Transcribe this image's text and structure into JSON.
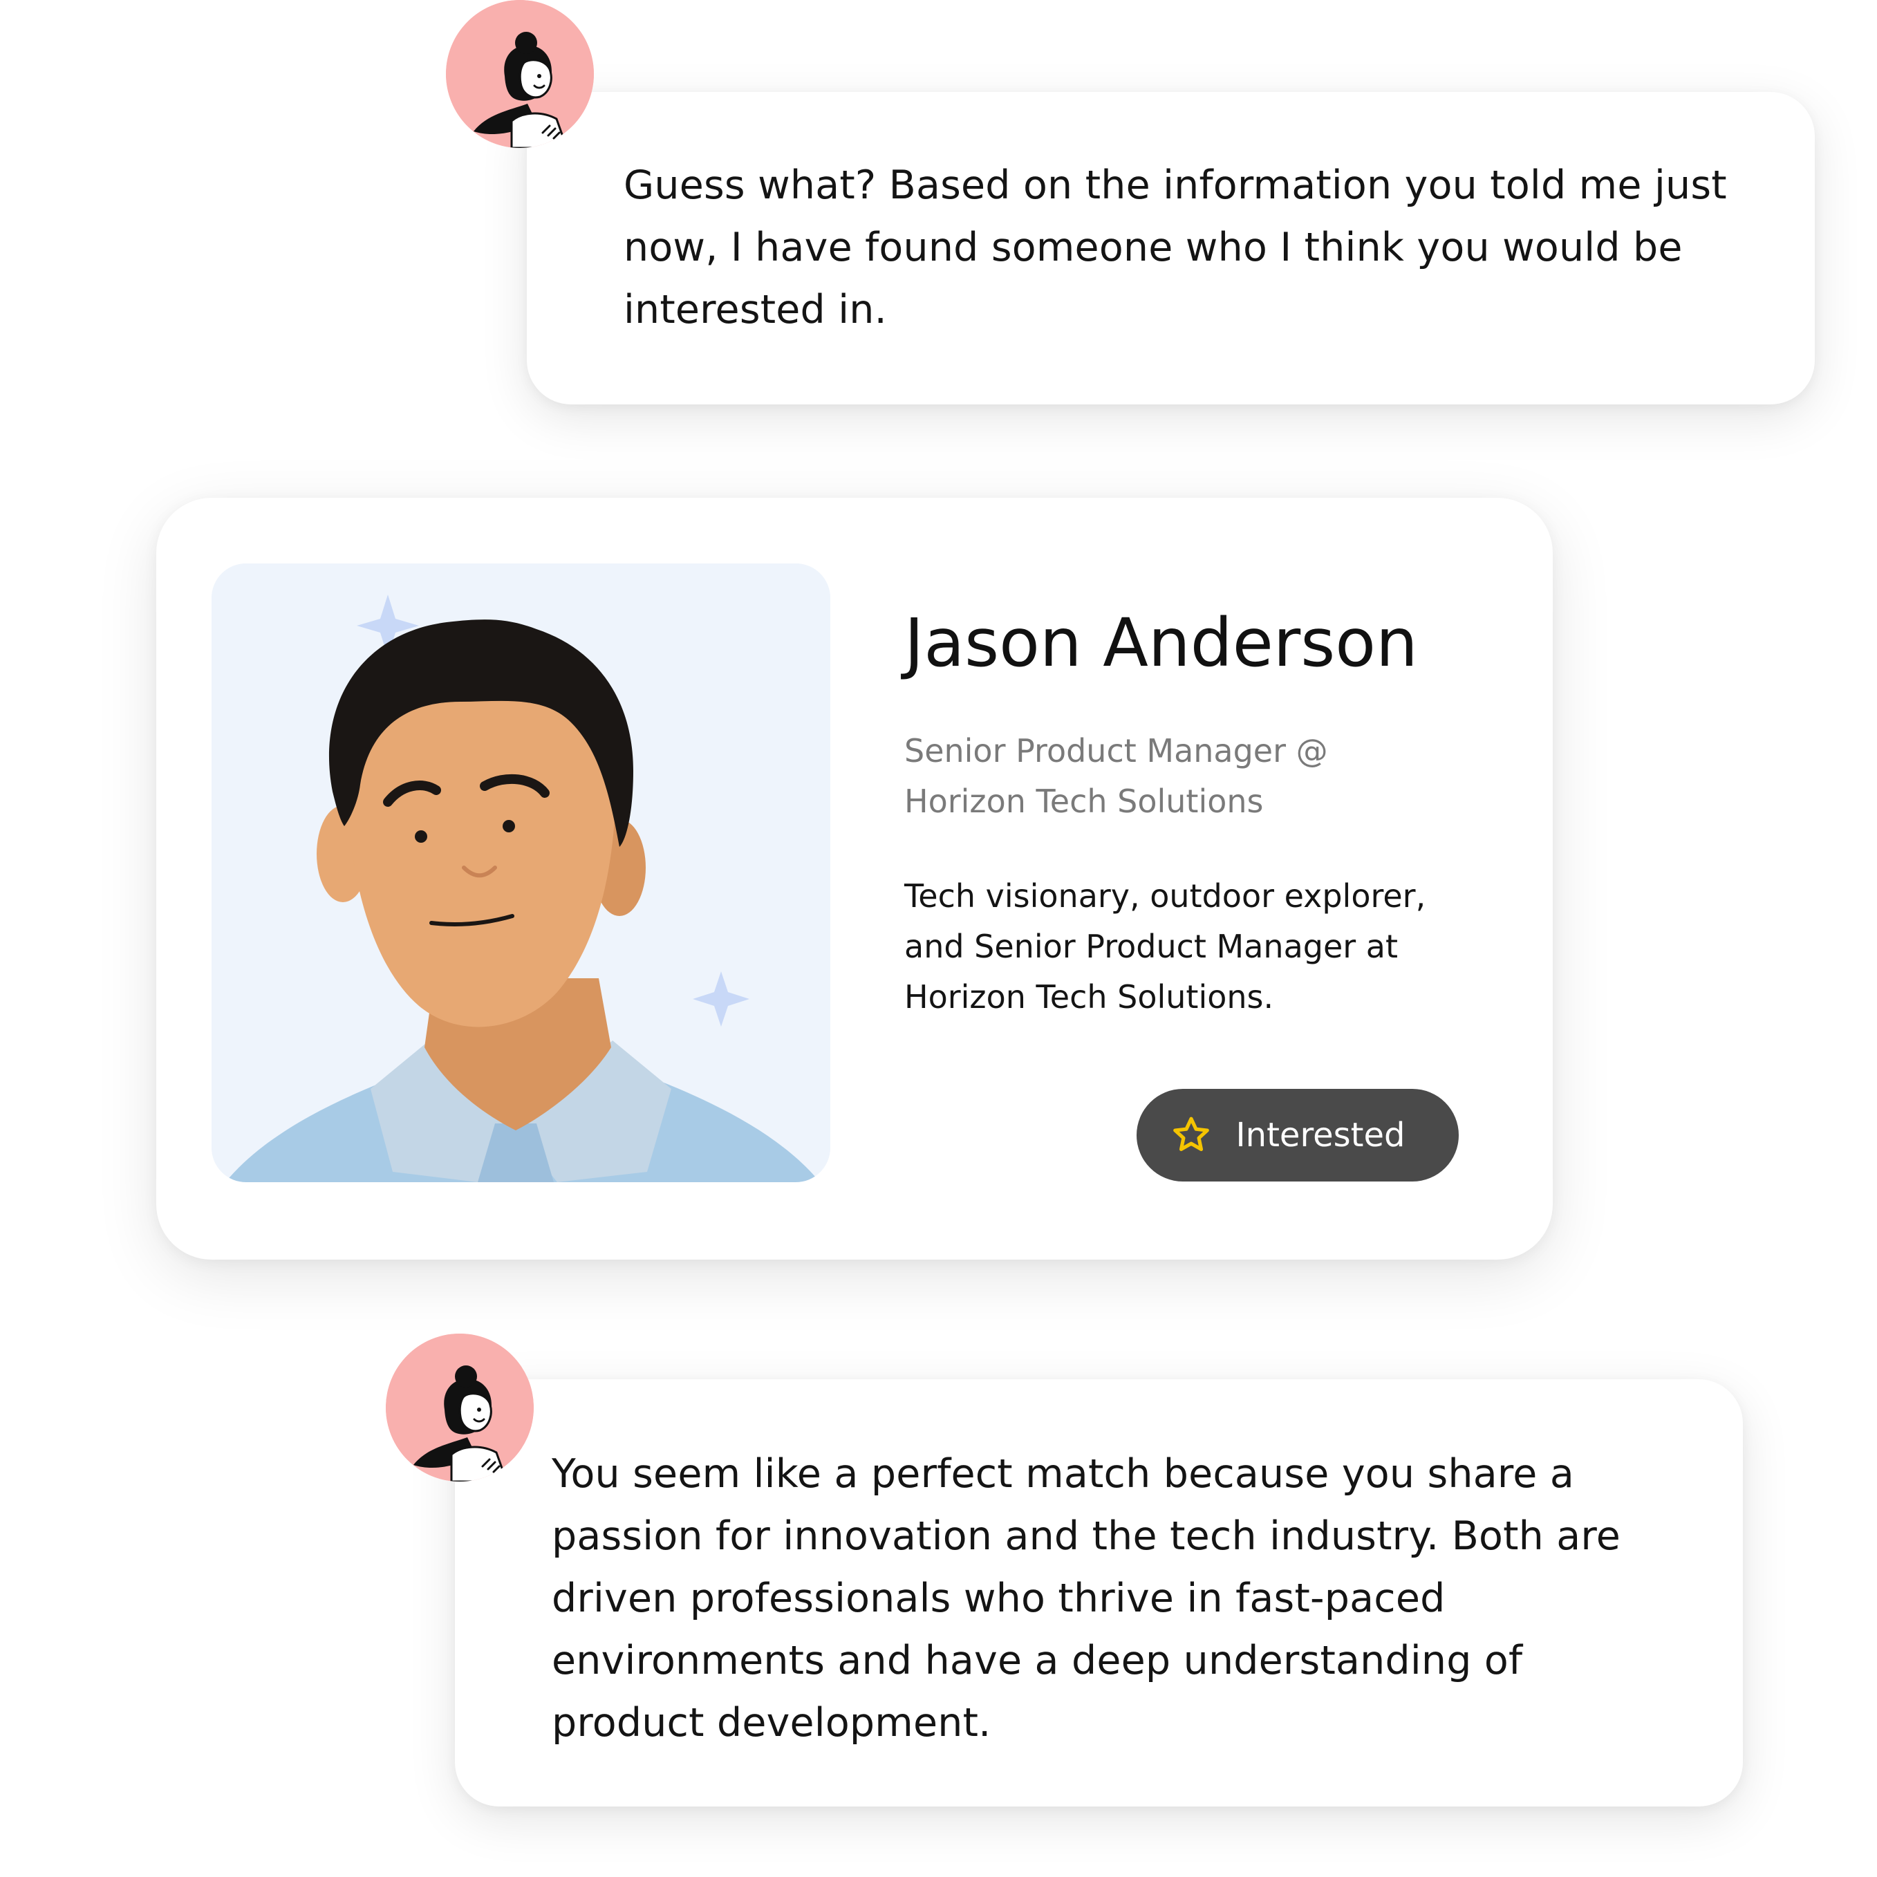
{
  "messages": [
    {
      "sender": "assistant",
      "text": "Guess what? Based on the information you told me just now, I have found someone who I think you would be interested in."
    },
    {
      "sender": "assistant",
      "text": "You seem like a perfect match because you share a passion for innovation and the tech industry. Both are driven professionals who thrive in fast-paced environments and have a deep understanding of product development."
    }
  ],
  "profile": {
    "name": "Jason Anderson",
    "title": "Senior Product Manager @ Horizon Tech Solutions",
    "bio": "Tech visionary, outdoor explorer, and Senior Product Manager at Horizon Tech Solutions.",
    "interested_label": "Interested"
  },
  "icons": {
    "avatar": "assistant-avatar-icon",
    "star": "star-icon",
    "sparkle": "sparkle-icon"
  },
  "colors": {
    "avatar_bg": "#f9b0ae",
    "button_bg": "#4a4a4a",
    "star": "#f5c400",
    "photo_bg": "#eef4fc",
    "shirt": "#a8cbe6"
  }
}
